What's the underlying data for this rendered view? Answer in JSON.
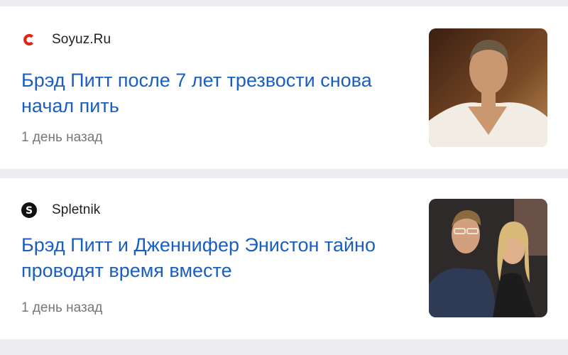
{
  "feed": {
    "items": [
      {
        "source": "Soyuz.Ru",
        "logo_icon": "soyuz-logo-icon",
        "logo_color": "#e2231a",
        "headline": "Брэд Питт после 7 лет трезвости снова начал пить",
        "time": "1 день назад",
        "thumbnail": "photo of man in white shirt"
      },
      {
        "source": "Spletnik",
        "logo_icon": "spletnik-logo-icon",
        "logo_color": "#111111",
        "headline": "Брэд Питт и Дженнифер Энистон тайно проводят время вместе",
        "time": "1 день назад",
        "thumbnail": "photo of couple"
      }
    ]
  },
  "colors": {
    "headline": "#1a5fbf",
    "time": "#777777",
    "background": "#ececf1"
  }
}
